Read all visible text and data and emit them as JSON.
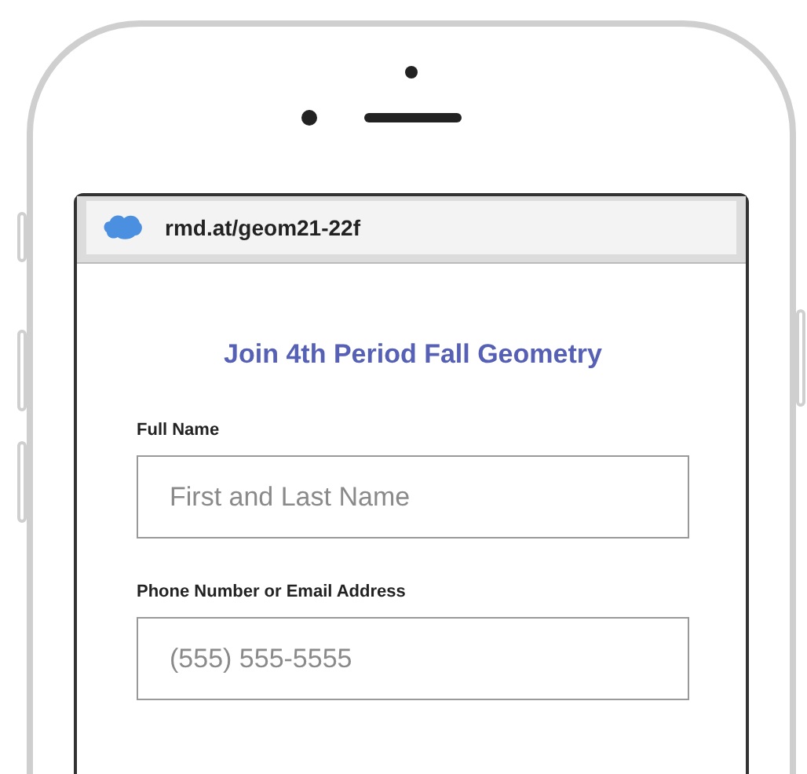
{
  "browser": {
    "url": "rmd.at/geom21-22f"
  },
  "form": {
    "title": "Join 4th Period Fall Geometry",
    "fields": [
      {
        "label": "Full Name",
        "placeholder": "First and Last Name"
      },
      {
        "label": "Phone Number or Email Address",
        "placeholder": "(555) 555-5555"
      }
    ]
  }
}
